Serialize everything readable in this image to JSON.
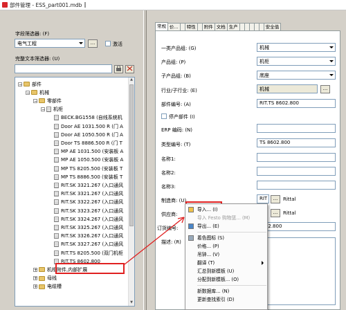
{
  "window": {
    "title": "部件管理 - ESS_part001.mdb"
  },
  "left": {
    "field_filter_label": "字段筛选器: (F)",
    "field_filter_value": "电气工程",
    "activate_label": "激活",
    "fulltext_label": "完整文本筛选器: (U)",
    "tree": [
      {
        "indent": 0,
        "expander": "−",
        "icon": "folder",
        "label": "部件"
      },
      {
        "indent": 1,
        "expander": "−",
        "icon": "folder",
        "label": "机械"
      },
      {
        "indent": 2,
        "expander": "−",
        "icon": "folder",
        "label": "零部件"
      },
      {
        "indent": 3,
        "expander": "−",
        "icon": "item",
        "label": "机柜"
      },
      {
        "indent": 4,
        "expander": "",
        "icon": "item",
        "label": "BECK.BG1558 (自线系统机"
      },
      {
        "indent": 4,
        "expander": "",
        "icon": "item",
        "label": "Door AE 1031.500 R (门 A"
      },
      {
        "indent": 4,
        "expander": "",
        "icon": "item",
        "label": "Door AE 1050.500 R (门 A"
      },
      {
        "indent": 4,
        "expander": "",
        "icon": "item",
        "label": "Door TS 8886.500 R (门 T"
      },
      {
        "indent": 4,
        "expander": "",
        "icon": "item",
        "label": "MP AE 1031.500 (安装板 A"
      },
      {
        "indent": 4,
        "expander": "",
        "icon": "item",
        "label": "MP AE 1050.500 (安装板 A"
      },
      {
        "indent": 4,
        "expander": "",
        "icon": "item",
        "label": "MP TS 8205.500 (安装板 T"
      },
      {
        "indent": 4,
        "expander": "",
        "icon": "item",
        "label": "MP TS 8886.500 (安装板 T"
      },
      {
        "indent": 4,
        "expander": "",
        "icon": "item",
        "label": "RIT.SK 3321.267 (入口通风"
      },
      {
        "indent": 4,
        "expander": "",
        "icon": "item",
        "label": "RIT.SK 3321.267 (入口通风"
      },
      {
        "indent": 4,
        "expander": "",
        "icon": "item",
        "label": "RIT.SK 3322.267 (入口通风"
      },
      {
        "indent": 4,
        "expander": "",
        "icon": "item",
        "label": "RIT.SK 3323.267 (入口通风"
      },
      {
        "indent": 4,
        "expander": "",
        "icon": "item",
        "label": "RIT.SK 3324.267 (入口通风"
      },
      {
        "indent": 4,
        "expander": "",
        "icon": "item",
        "label": "RIT.SK 3325.267 (入口通风"
      },
      {
        "indent": 4,
        "expander": "",
        "icon": "item",
        "label": "RIT.SK 3326.267 (入口通风"
      },
      {
        "indent": 4,
        "expander": "",
        "icon": "item",
        "label": "RIT.SK 3327.267 (入口通风"
      },
      {
        "indent": 4,
        "expander": "",
        "icon": "item",
        "label": "RIT.TS 8205.500 (双门机柜"
      },
      {
        "indent": 4,
        "expander": "",
        "icon": "item",
        "label": "RIT.TS 8602.800",
        "selected": true
      },
      {
        "indent": 2,
        "expander": "+",
        "icon": "folder",
        "label": "机柜附件,内部扩展"
      },
      {
        "indent": 2,
        "expander": "+",
        "icon": "folder",
        "label": "母线"
      },
      {
        "indent": 2,
        "expander": "+",
        "icon": "folder",
        "label": "电缆槽"
      }
    ]
  },
  "tabs": [
    "常规",
    "价...",
    "",
    "特性",
    "",
    "附件",
    "文档",
    "生产",
    "",
    "",
    "",
    "",
    "",
    "安全值"
  ],
  "form": {
    "l_group": "一类产品组: (G)",
    "v_group": "机械",
    "l_pgroup": "产品组: (P)",
    "v_pgroup": "机柜",
    "l_subgroup": "子产品组: (B)",
    "v_subgroup": "底座",
    "l_industry": "行业/子行业: (E)",
    "v_industry": "机械",
    "l_partno": "部件编号: (A)",
    "v_partno": "RIT.TS 8602.800",
    "l_discontinued": "停产部件 (I)",
    "l_erp": "ERP 编码: (N)",
    "l_type": "类型编号: (T)",
    "v_type": "TS 8602.800",
    "l_name1": "名称1:",
    "l_name2": "名称2:",
    "l_name3": "名称3:",
    "l_manufacturer": "制造商: (U)",
    "v_manufacturer_code": "RIT",
    "v_manufacturer": "Rittal",
    "l_supplier": "供应商:",
    "v_supplier": "Rittal",
    "l_order": "订货编号:",
    "v_order": "8602.800",
    "l_desc": "描述: (R)"
  },
  "context_menu": [
    {
      "label": "导入... (I)",
      "icon": "import-icon"
    },
    {
      "label": "导入 Festo 购物篮... (M)",
      "disabled": true
    },
    {
      "label": "导出... (E)",
      "icon": "export-icon"
    },
    {
      "sep": true
    },
    {
      "label": "着色图标 (S)",
      "icon": "color-icon"
    },
    {
      "label": "价格... (P)"
    },
    {
      "label": "吊钟... (V)"
    },
    {
      "label": "翻译 (T)",
      "submenu": true
    },
    {
      "label": "汇总到新模板 (U)"
    },
    {
      "label": "分配到新模板... (O)"
    },
    {
      "sep": true
    },
    {
      "label": "新数据库... (N)"
    },
    {
      "label": "更新查找索引 (D)"
    }
  ]
}
